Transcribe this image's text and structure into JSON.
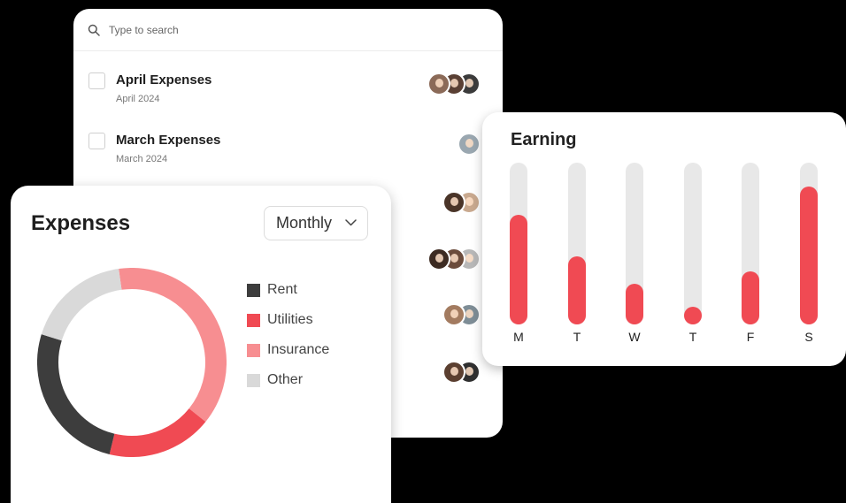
{
  "search": {
    "placeholder": "Type to search"
  },
  "expense_list": [
    {
      "title": "April Expenses",
      "date": "April 2024",
      "avatars": [
        "avatar-1",
        "avatar-2",
        "avatar-3"
      ]
    },
    {
      "title": "March Expenses",
      "date": "March 2024",
      "avatars": [
        "avatar-1"
      ]
    },
    {
      "title": "",
      "date": "",
      "avatars": [
        "avatar-1",
        "avatar-2"
      ]
    },
    {
      "title": "",
      "date": "",
      "avatars": [
        "avatar-1",
        "avatar-2",
        "avatar-3"
      ]
    },
    {
      "title": "",
      "date": "",
      "avatars": [
        "avatar-1",
        "avatar-2"
      ]
    },
    {
      "title": "",
      "date": "",
      "avatars": [
        "avatar-1",
        "avatar-2"
      ]
    }
  ],
  "earning": {
    "title": "Earning",
    "days": [
      "M",
      "T",
      "W",
      "T",
      "F",
      "S"
    ],
    "levels": [
      0.68,
      0.42,
      0.25,
      0.06,
      0.33,
      0.85
    ],
    "colors": {
      "track": "#e8e8e8",
      "fill": "#f04a53"
    }
  },
  "expenses": {
    "title": "Expenses",
    "period": "Monthly",
    "legend": [
      {
        "label": "Rent",
        "color": "#3d3d3d"
      },
      {
        "label": "Utilities",
        "color": "#f04a53"
      },
      {
        "label": "Insurance",
        "color": "#f78e91"
      },
      {
        "label": "Other",
        "color": "#d9d9d9"
      }
    ],
    "shares": {
      "Insurance": 0.38,
      "Utilities": 0.18,
      "Rent": 0.26,
      "Other": 0.18
    }
  }
}
